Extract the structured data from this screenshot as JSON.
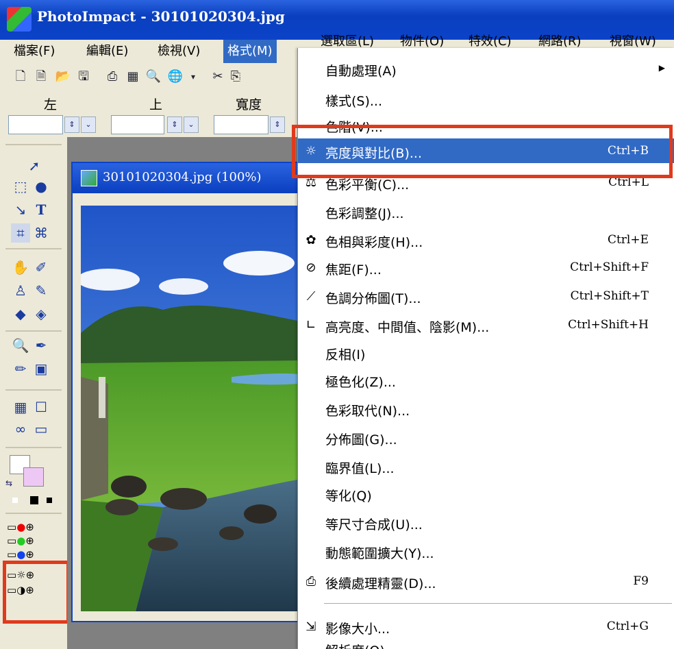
{
  "window": {
    "title": "PhotoImpact - 30101020304.jpg"
  },
  "menubar": {
    "items": [
      "檔案(F)",
      "編輯(E)",
      "檢視(V)",
      "格式(M)",
      "選取區(L)",
      "物件(O)",
      "特效(C)",
      "網路(R)",
      "視窗(W)"
    ]
  },
  "toolbar": {
    "field_labels": [
      "左",
      "上",
      "寬度"
    ]
  },
  "document": {
    "title": "30101020304.jpg (100%)"
  },
  "format_menu": {
    "items": [
      {
        "label": "自動處理(A)",
        "shortcut": "",
        "icon": "",
        "submenu": true
      },
      {
        "label": "樣式(S)...",
        "shortcut": "",
        "icon": ""
      },
      {
        "label": "色階(V)...",
        "shortcut": "",
        "icon": ""
      },
      {
        "label": "亮度與對比(B)...",
        "shortcut": "Ctrl+B",
        "icon": "brightness-icon",
        "highlighted": true
      },
      {
        "label": "色彩平衡(C)...",
        "shortcut": "Ctrl+L",
        "icon": "color-balance-icon"
      },
      {
        "label": "色彩調整(J)...",
        "shortcut": "",
        "icon": ""
      },
      {
        "label": "色相與彩度(H)...",
        "shortcut": "Ctrl+E",
        "icon": "hue-saturation-icon"
      },
      {
        "label": "焦距(F)...",
        "shortcut": "Ctrl+Shift+F",
        "icon": "focus-icon"
      },
      {
        "label": "色調分佈圖(T)...",
        "shortcut": "Ctrl+Shift+T",
        "icon": "tone-map-icon"
      },
      {
        "label": "高亮度、中間值、陰影(M)...",
        "shortcut": "Ctrl+Shift+H",
        "icon": "highlight-midtone-shadow-icon"
      },
      {
        "label": "反相(I)",
        "shortcut": "",
        "icon": ""
      },
      {
        "label": "極色化(Z)...",
        "shortcut": "",
        "icon": ""
      },
      {
        "label": "色彩取代(N)...",
        "shortcut": "",
        "icon": ""
      },
      {
        "label": "分佈圖(G)...",
        "shortcut": "",
        "icon": ""
      },
      {
        "label": "臨界值(L)...",
        "shortcut": "",
        "icon": ""
      },
      {
        "label": "等化(Q)",
        "shortcut": "",
        "icon": ""
      },
      {
        "label": "等尺寸合成(U)...",
        "shortcut": "",
        "icon": ""
      },
      {
        "label": "動態範圍擴大(Y)...",
        "shortcut": "",
        "icon": ""
      },
      {
        "label": "後續處理精靈(D)...",
        "shortcut": "F9",
        "icon": "post-processing-wizard-icon"
      },
      {
        "label": "影像大小...",
        "shortcut": "Ctrl+G",
        "icon": "image-size-icon"
      },
      {
        "label": "解析度(O)...",
        "shortcut": "",
        "icon": ""
      }
    ]
  },
  "colors": {
    "highlight": "#316ac5",
    "callout": "#e03a1c",
    "menubar": "#ece9d8"
  }
}
